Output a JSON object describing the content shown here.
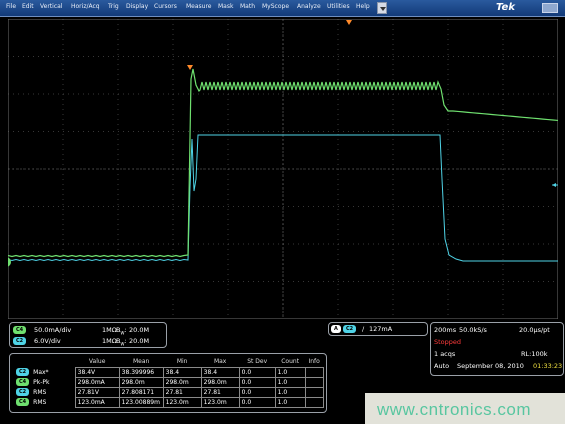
{
  "menubar": {
    "items": [
      "File",
      "Edit",
      "Vertical",
      "Horiz/Acq",
      "Trig",
      "Display",
      "Cursors",
      "Measure",
      "Mask",
      "Math",
      "MyScope",
      "Analyze",
      "Utilities",
      "Help"
    ],
    "brand": "Tek"
  },
  "colors": {
    "ch1": "#e6e600",
    "ch2": "#4fd3e6",
    "ch3": "#f28bb8",
    "ch4": "#6fe06f",
    "grid": "#6e6e6e"
  },
  "channels": {
    "ch4": {
      "label": "C4",
      "scale": "50.0mA/div",
      "input": "1MΩ",
      "bw": "20.0M"
    },
    "ch2": {
      "label": "C2",
      "scale": "6.0V/div",
      "input": "1MΩ",
      "bw": "20.0M"
    }
  },
  "trigger": {
    "source": "C2",
    "slope": "/",
    "level": "127mA"
  },
  "acquisition": {
    "timebase": "200ms",
    "sample_rate": "50.0kS/s",
    "resolution": "20.0µs/pt",
    "state": "Stopped",
    "acqs": "1 acqs",
    "record_length": "RL:100k",
    "mode": "Auto",
    "date": "September 08, 2010",
    "time": "01:33:23"
  },
  "measurements": {
    "headers": [
      "",
      "",
      "Value",
      "Mean",
      "Min",
      "Max",
      "St Dev",
      "Count",
      "Info"
    ],
    "rows": [
      {
        "ch": "C2",
        "name": "Max*",
        "value": "38.4V",
        "mean": "38.399996",
        "min": "38.4",
        "max": "38.4",
        "stdev": "0.0",
        "count": "1.0"
      },
      {
        "ch": "C4",
        "name": "Pk-Pk",
        "value": "298.0mA",
        "mean": "298.0m",
        "min": "298.0m",
        "max": "298.0m",
        "stdev": "0.0",
        "count": "1.0"
      },
      {
        "ch": "C2",
        "name": "RMS",
        "value": "27.81V",
        "mean": "27.808171",
        "min": "27.81",
        "max": "27.81",
        "stdev": "0.0",
        "count": "1.0"
      },
      {
        "ch": "C4",
        "name": "RMS",
        "value": "123.0mA",
        "mean": "123.00889m",
        "min": "123.0m",
        "max": "123.0m",
        "stdev": "0.0",
        "count": "1.0"
      }
    ]
  },
  "watermark": "www.cntronics.com"
}
